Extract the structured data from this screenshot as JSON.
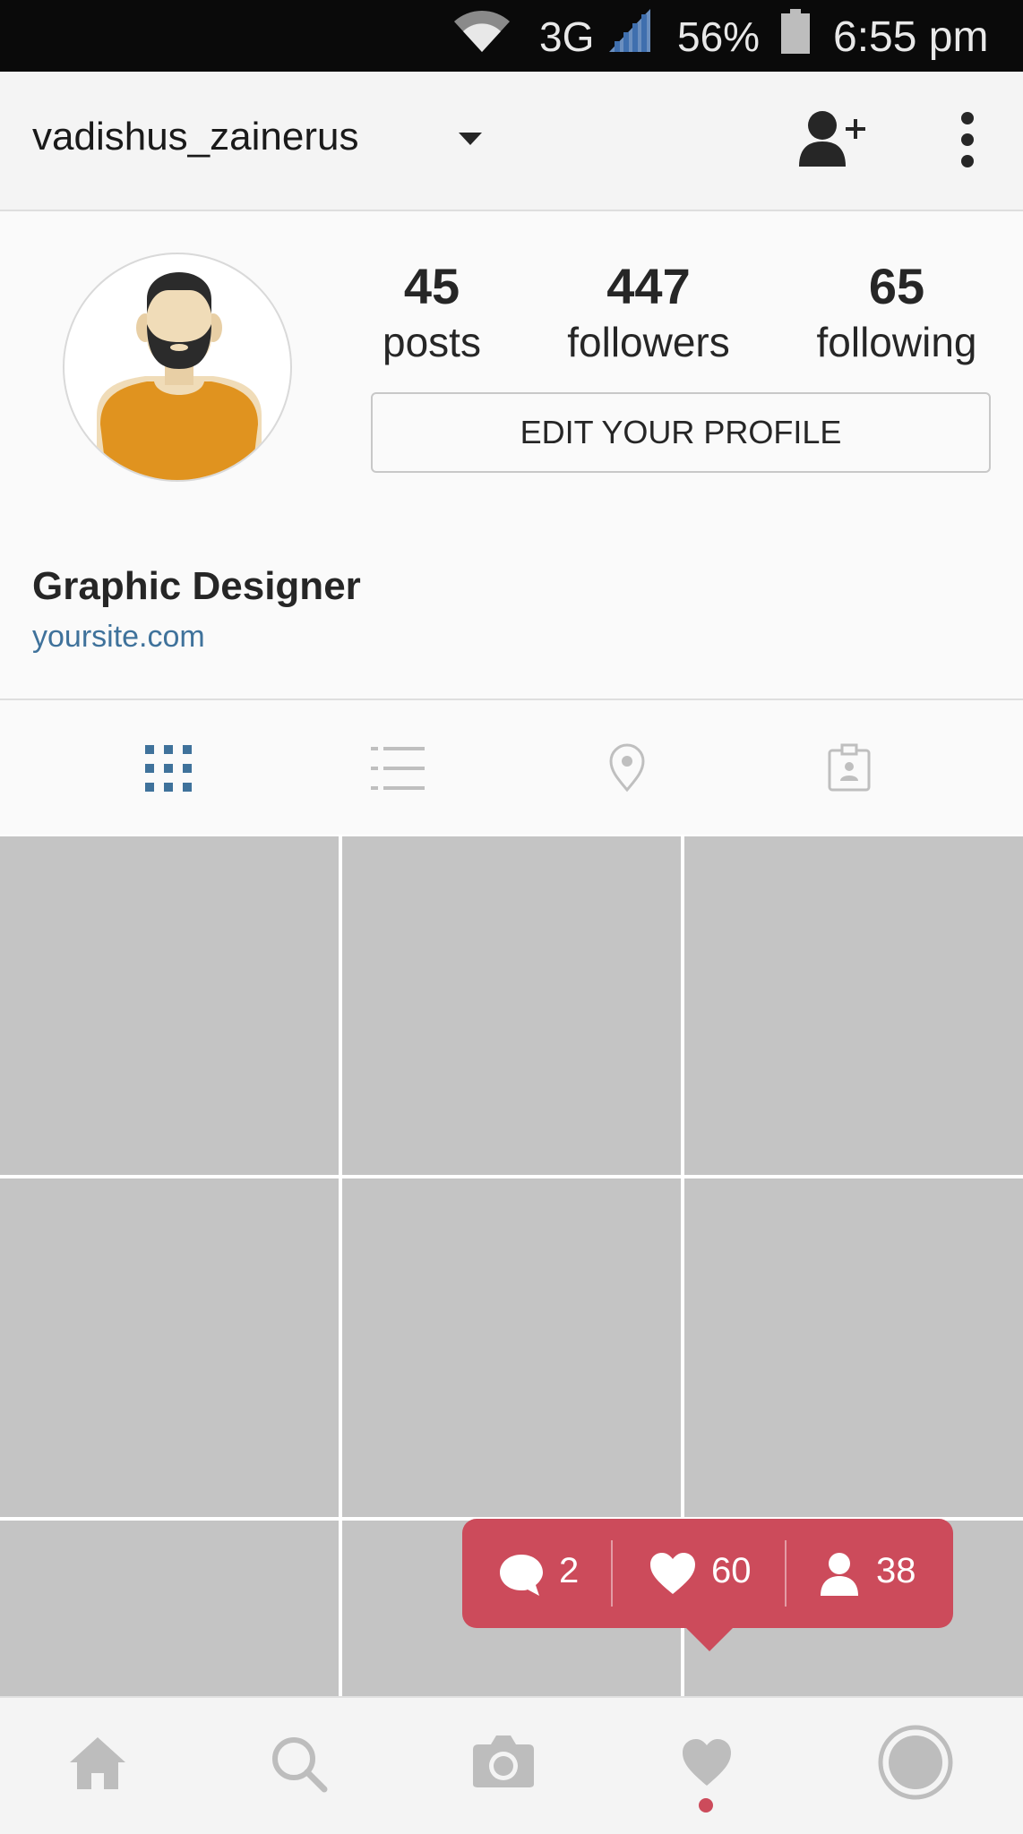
{
  "status_bar": {
    "network": "3G",
    "battery": "56%",
    "time": "6:55 pm"
  },
  "header": {
    "username": "vadishus_zainerus"
  },
  "profile": {
    "stats": [
      {
        "value": "45",
        "label": "posts"
      },
      {
        "value": "447",
        "label": "followers"
      },
      {
        "value": "65",
        "label": "following"
      }
    ],
    "edit_button": "EDIT YOUR PROFILE",
    "bio_name": "Graphic Designer",
    "website": "yoursite.com"
  },
  "tabs": [
    {
      "icon": "grid-view-icon",
      "active": true
    },
    {
      "icon": "list-view-icon",
      "active": false
    },
    {
      "icon": "location-pin-icon",
      "active": false
    },
    {
      "icon": "tagged-photos-icon",
      "active": false
    }
  ],
  "activity_popup": {
    "comments": "2",
    "likes": "60",
    "followers": "38"
  },
  "bottom_nav": [
    {
      "icon": "home-icon"
    },
    {
      "icon": "search-icon"
    },
    {
      "icon": "camera-icon"
    },
    {
      "icon": "heart-icon",
      "active": true
    },
    {
      "icon": "profile-icon"
    }
  ],
  "colors": {
    "accent_blue": "#3f729b",
    "popup_red": "#cc4b5b",
    "placeholder_gray": "#c4c4c4"
  }
}
